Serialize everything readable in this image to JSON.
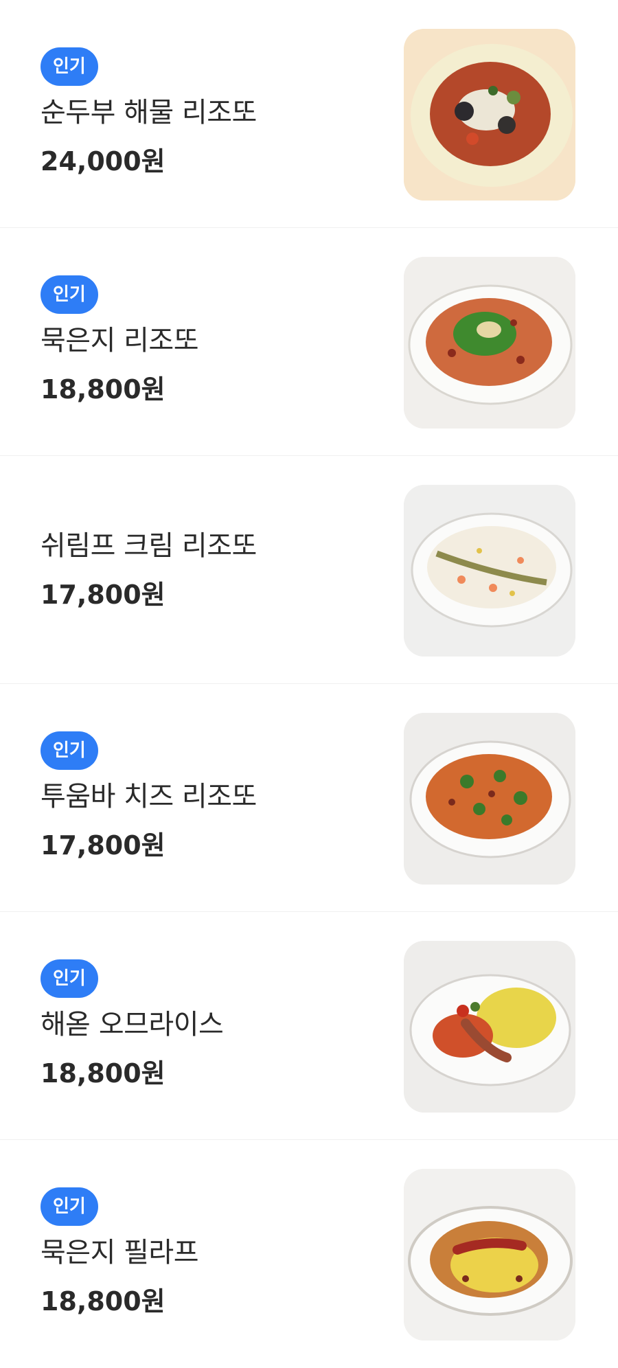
{
  "menu": {
    "items": [
      {
        "badge": "인기",
        "name": "순두부 해물 리조또",
        "price": "24,000원",
        "image": "food-photo",
        "dish": "seafood-risotto"
      },
      {
        "badge": "인기",
        "name": "묵은지 리조또",
        "price": "18,800원",
        "image": "food-photo",
        "dish": "kimchi-risotto"
      },
      {
        "badge": "",
        "name": "쉬림프 크림 리조또",
        "price": "17,800원",
        "image": "food-photo",
        "dish": "shrimp-cream-risotto"
      },
      {
        "badge": "인기",
        "name": "투움바 치즈 리조또",
        "price": "17,800원",
        "image": "food-photo",
        "dish": "toowoomba-risotto"
      },
      {
        "badge": "인기",
        "name": "해옫 오므라이스",
        "price": "18,800원",
        "image": "food-photo",
        "dish": "omurice"
      },
      {
        "badge": "인기",
        "name": "묵은지 필라프",
        "price": "18,800원",
        "image": "food-photo",
        "dish": "kimchi-pilaf"
      }
    ]
  },
  "colors": {
    "badge_bg": "#2e7df6",
    "text": "#2a2a2a",
    "divider": "#efefef"
  }
}
